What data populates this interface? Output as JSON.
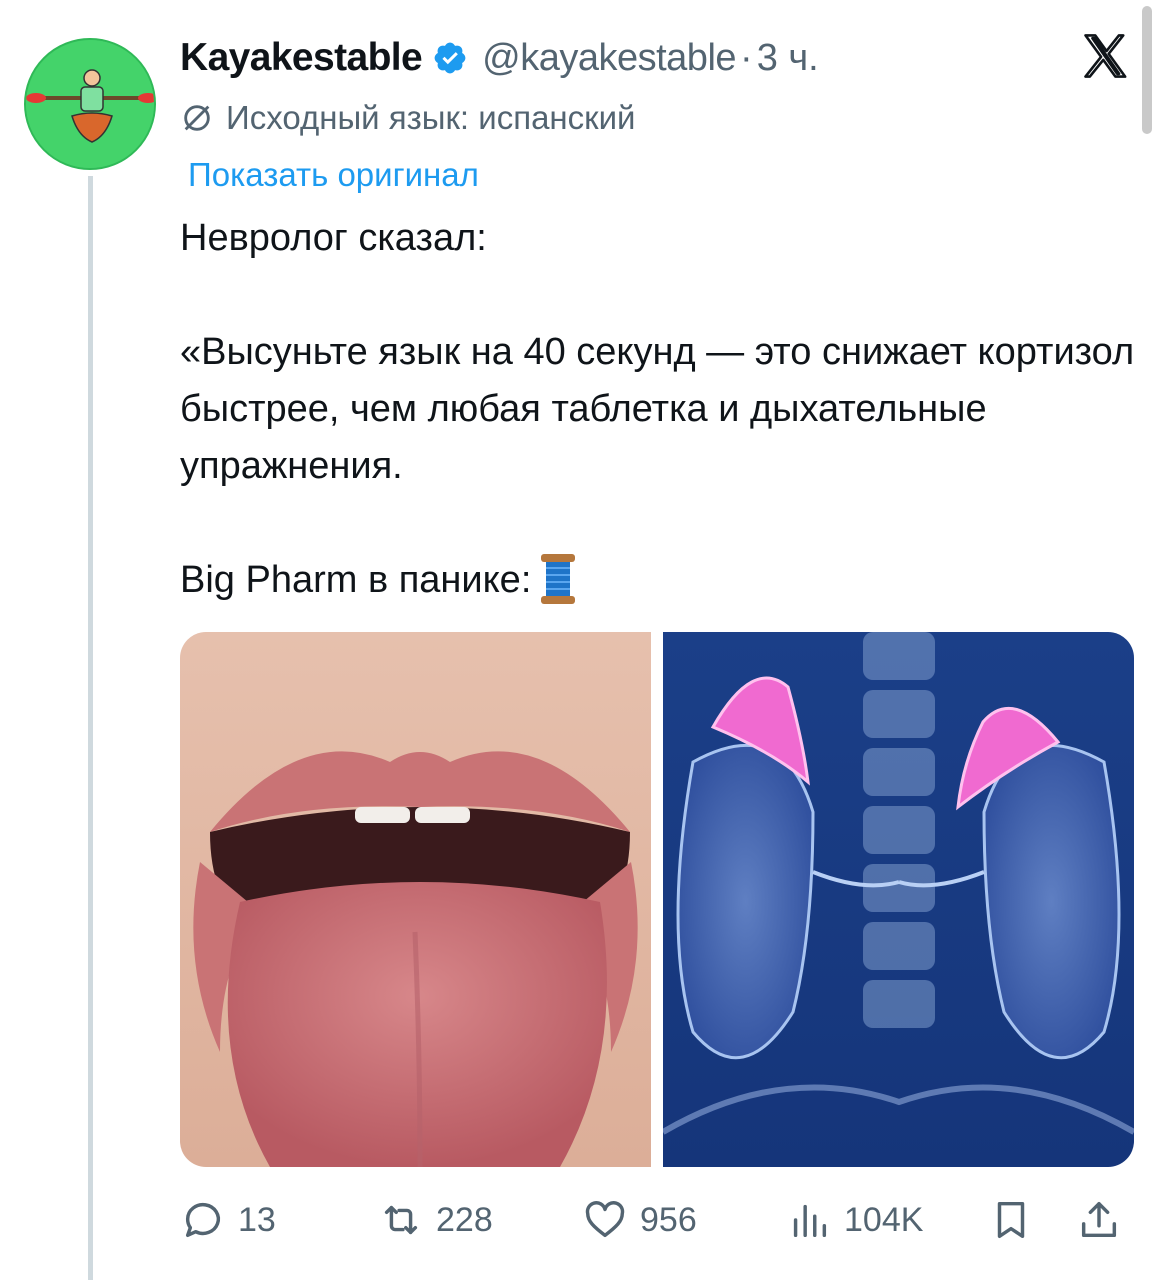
{
  "tweet": {
    "display_name": "Kayakestable",
    "handle": "@kayakestable",
    "separator": "·",
    "time": "3 ч.",
    "translation_note": "Исходный язык: испанский",
    "show_original": "Показать оригинал",
    "lines": [
      "Невролог сказал:",
      "«Высуньте язык на 40 секунд — это снижает кортизол быстрее, чем любая таблетка и дыхательные упражнения.",
      "Big Pharm в панике:"
    ]
  },
  "actions": {
    "replies": "13",
    "reposts": "228",
    "likes": "956",
    "views": "104K"
  },
  "icons": {
    "verified": "verified-badge-icon",
    "translate": "translate-icon",
    "x_logo": "x-logo-icon",
    "spool": "thread-spool-emoji",
    "reply": "reply-icon",
    "repost": "repost-icon",
    "like": "heart-icon",
    "views": "views-icon",
    "bookmark": "bookmark-icon",
    "share": "share-icon"
  },
  "colors": {
    "link": "#1d9bf0",
    "secondary_text": "#536471",
    "avatar_bg": "#44d36a"
  }
}
